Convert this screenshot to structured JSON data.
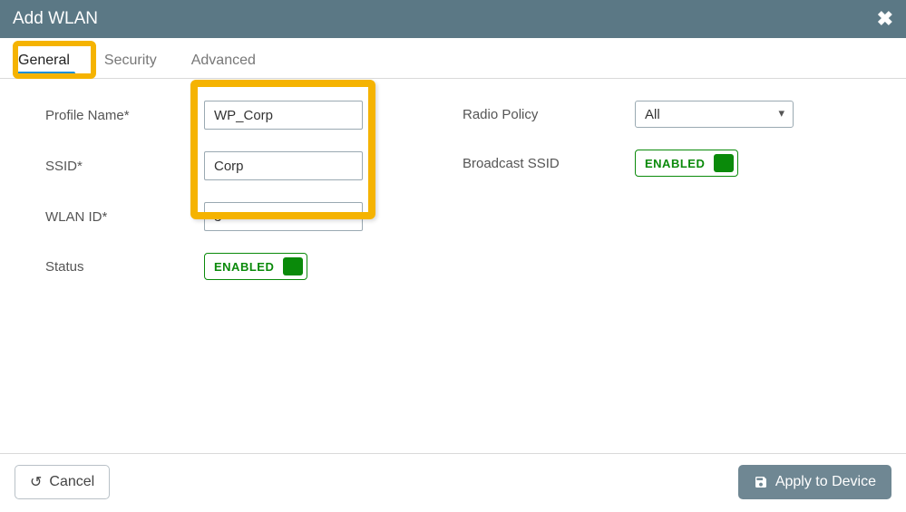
{
  "header": {
    "title": "Add WLAN"
  },
  "tabs": {
    "general": "General",
    "security": "Security",
    "advanced": "Advanced"
  },
  "form": {
    "profile_name_label": "Profile Name*",
    "profile_name_value": "WP_Corp",
    "ssid_label": "SSID*",
    "ssid_value": "Corp",
    "wlan_id_label": "WLAN ID*",
    "wlan_id_value": "3",
    "status_label": "Status",
    "status_state": "ENABLED",
    "radio_policy_label": "Radio Policy",
    "radio_policy_value": "All",
    "broadcast_ssid_label": "Broadcast SSID",
    "broadcast_ssid_state": "ENABLED"
  },
  "footer": {
    "cancel": "Cancel",
    "apply": "Apply to Device"
  }
}
